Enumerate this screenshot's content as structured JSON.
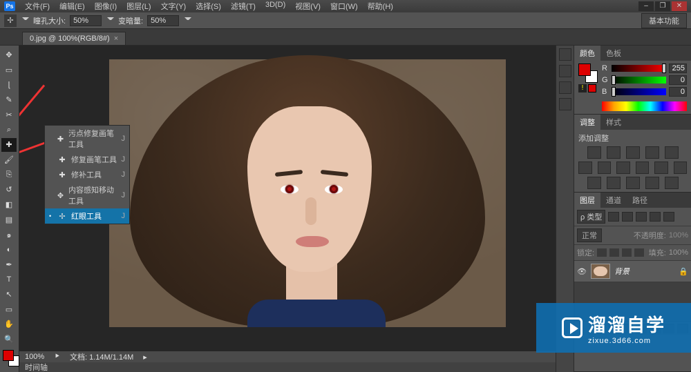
{
  "app": {
    "name": "Ps"
  },
  "menu": [
    "文件(F)",
    "编辑(E)",
    "图像(I)",
    "图层(L)",
    "文字(Y)",
    "选择(S)",
    "滤镜(T)",
    "3D(D)",
    "视图(V)",
    "窗口(W)",
    "帮助(H)"
  ],
  "options_bar": {
    "pupil_label": "瞳孔大小:",
    "pupil_value": "50%",
    "darken_label": "变暗量:",
    "darken_value": "50%",
    "workspace": "基本功能"
  },
  "doc_tab": {
    "title": "0.jpg @ 100%(RGB/8#)"
  },
  "flyout": {
    "items": [
      {
        "icon": "✚",
        "label": "污点修复画笔工具",
        "shortcut": "J",
        "selected": false
      },
      {
        "icon": "✚",
        "label": "修复画笔工具",
        "shortcut": "J",
        "selected": false
      },
      {
        "icon": "✚",
        "label": "修补工具",
        "shortcut": "J",
        "selected": false
      },
      {
        "icon": "✥",
        "label": "内容感知移动工具",
        "shortcut": "J",
        "selected": false
      },
      {
        "icon": "✢",
        "label": "红眼工具",
        "shortcut": "J",
        "selected": true
      }
    ]
  },
  "status": {
    "zoom": "100%",
    "doc_label": "文档:",
    "doc_value": "1.14M/1.14M"
  },
  "timeline": {
    "label": "时间轴"
  },
  "color_panel": {
    "tabs": [
      "颜色",
      "色板"
    ],
    "r": {
      "label": "R",
      "value": "255",
      "pos": 100
    },
    "g": {
      "label": "G",
      "value": "0",
      "pos": 0
    },
    "b": {
      "label": "B",
      "value": "0",
      "pos": 0
    }
  },
  "adjust_panel": {
    "tabs": [
      "调整",
      "样式"
    ],
    "heading": "添加调整"
  },
  "layers_panel": {
    "tabs": [
      "图层",
      "通道",
      "路径"
    ],
    "kind_label": "ρ 类型",
    "blend_mode": "正常",
    "opacity_label": "不透明度:",
    "opacity_value": "100%",
    "lock_label": "锁定:",
    "fill_label": "填充:",
    "fill_value": "100%",
    "layer": {
      "name": "背景"
    }
  },
  "watermark": {
    "big": "溜溜自学",
    "small": "zixue.3d66.com"
  }
}
